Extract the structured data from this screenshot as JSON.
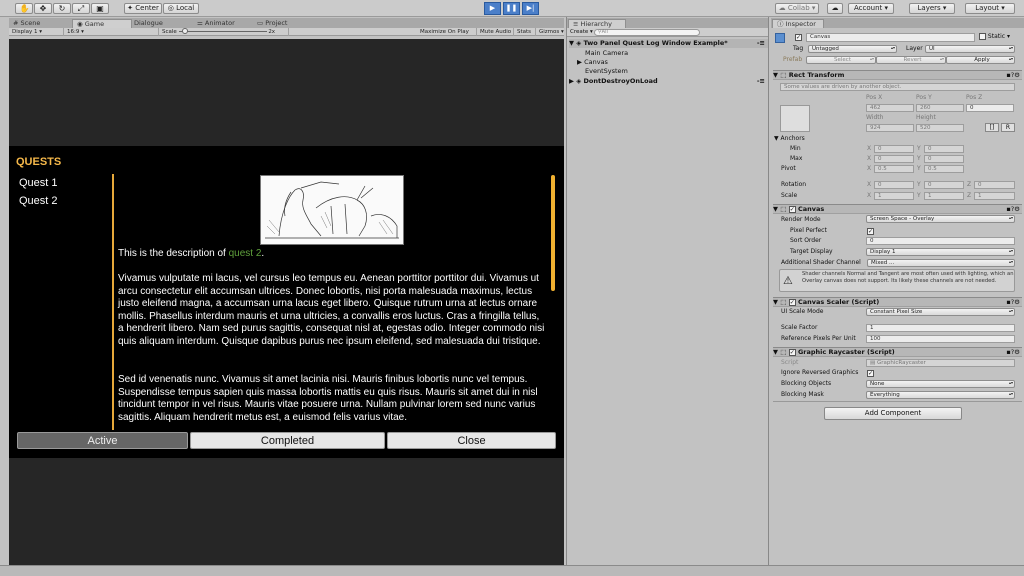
{
  "toolbar": {
    "center": "Center",
    "local": "Local",
    "collab": "Collab",
    "account": "Account",
    "layers": "Layers",
    "layout": "Layout"
  },
  "scene_tabs": [
    "Scene",
    "Game",
    "Dialogue",
    "Animator",
    "Project"
  ],
  "game_bar": {
    "display": "Display 1",
    "aspect": "16:9",
    "scale_label": "Scale",
    "scale_value": "2x",
    "maximize": "Maximize On Play",
    "mute": "Mute Audio",
    "stats": "Stats",
    "gizmos": "Gizmos"
  },
  "game_ui": {
    "title": "QUESTS",
    "quests": [
      "Quest 1",
      "Quest 2"
    ],
    "desc_prefix": "This is the description of ",
    "desc_link": "quest 2",
    "desc_suffix": ".",
    "para1": "Vivamus vulputate mi lacus, vel cursus leo tempus eu. Aenean porttitor porttitor dui. Vivamus ut arcu consectetur elit accumsan ultrices. Donec lobortis, nisi porta malesuada maximus, lectus justo eleifend magna, a accumsan urna lacus eget libero. Quisque rutrum urna at lectus ornare mollis. Phasellus interdum mauris et urna ultricies, a convallis eros luctus. Cras a fringilla tellus, a hendrerit libero. Nam sed purus sagittis, consequat nisl at, egestas odio. Integer commodo nisi quis aliquam interdum. Quisque dapibus purus nec ipsum eleifend, sed malesuada dui tristique.",
    "para2": "Sed id venenatis nunc. Vivamus sit amet lacinia nisi. Mauris finibus lobortis nunc vel tempus. Suspendisse tempus sapien quis massa lobortis mattis eu quis risus. Mauris sit amet dui in nisl tincidunt tempor in vel risus. Mauris vitae posuere urna. Nullam pulvinar lorem sed nunc varius sagittis. Aliquam hendrerit metus est, a euismod felis varius vitae.",
    "tab_active": "Active",
    "tab_completed": "Completed",
    "tab_close": "Close"
  },
  "hierarchy": {
    "title": "Hierarchy",
    "create": "Create",
    "search": "All",
    "scene": "Two Panel Quest Log Window Example*",
    "items": [
      "Main Camera",
      "Canvas",
      "EventSystem"
    ],
    "ddol": "DontDestroyOnLoad"
  },
  "inspector": {
    "tab": "Inspector",
    "name": "Canvas",
    "static": "Static",
    "tag_label": "Tag",
    "tag": "Untagged",
    "layer_label": "Layer",
    "layer": "UI",
    "prefab": "Prefab",
    "select": "Select",
    "revert": "Revert",
    "apply": "Apply",
    "rect_transform": "Rect Transform",
    "driven_note": "Some values are driven by another object.",
    "pos_x_label": "Pos X",
    "pos_y_label": "Pos Y",
    "pos_z_label": "Pos Z",
    "pos_x": "462",
    "pos_y": "260",
    "pos_z": "0",
    "width_label": "Width",
    "height_label": "Height",
    "width": "924",
    "height": "520",
    "anchors": "Anchors",
    "min": "Min",
    "max": "Max",
    "pivot": "Pivot",
    "rotation": "Rotation",
    "scale": "Scale",
    "x": "X",
    "y": "Y",
    "z": "Z",
    "min_x": "0",
    "min_y": "0",
    "max_x": "0",
    "max_y": "0",
    "pivot_x": "0.5",
    "pivot_y": "0.5",
    "rot_x": "0",
    "rot_y": "0",
    "rot_z": "0",
    "scale_x": "1",
    "scale_y": "1",
    "scale_z": "1",
    "canvas": "Canvas",
    "render_mode_label": "Render Mode",
    "render_mode": "Screen Space - Overlay",
    "pixel_perfect": "Pixel Perfect",
    "sort_order_label": "Sort Order",
    "sort_order": "0",
    "target_display_label": "Target Display",
    "target_display": "Display 1",
    "shader_label": "Additional Shader Channel",
    "shader": "Mixed ...",
    "warning": "Shader channels Normal and Tangent are most often used with lighting, which an Overlay canvas does not support. Its likely these channels are not needed.",
    "scaler": "Canvas Scaler (Script)",
    "ui_scale_label": "UI Scale Mode",
    "ui_scale": "Constant Pixel Size",
    "scale_factor_label": "Scale Factor",
    "scale_factor": "1",
    "ref_ppu_label": "Reference Pixels Per Unit",
    "ref_ppu": "100",
    "raycaster": "Graphic Raycaster (Script)",
    "script_label": "Script",
    "script": "GraphicRaycaster",
    "ignore_reversed": "Ignore Reversed Graphics",
    "blocking_objects_label": "Blocking Objects",
    "blocking_objects": "None",
    "blocking_mask_label": "Blocking Mask",
    "blocking_mask": "Everything",
    "add_component": "Add Component"
  }
}
